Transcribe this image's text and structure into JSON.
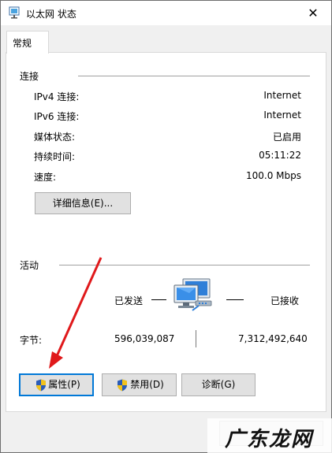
{
  "window": {
    "title": "以太网 状态",
    "close_glyph": "✕"
  },
  "tabs": [
    {
      "label": "常规"
    }
  ],
  "connection": {
    "group_label": "连接",
    "rows": [
      {
        "label": "IPv4 连接:",
        "value": "Internet"
      },
      {
        "label": "IPv6 连接:",
        "value": "Internet"
      },
      {
        "label": "媒体状态:",
        "value": "已启用"
      },
      {
        "label": "持续时间:",
        "value": "05:11:22"
      },
      {
        "label": "速度:",
        "value": "100.0 Mbps"
      }
    ],
    "details_button": "详细信息(E)..."
  },
  "activity": {
    "group_label": "活动",
    "sent_label": "已发送",
    "received_label": "已接收",
    "bytes_label": "字节:",
    "bytes_sent": "596,039,087",
    "bytes_received": "7,312,492,640",
    "network_icon": "network-computers-icon"
  },
  "buttons": {
    "properties": "属性(P)",
    "disable": "禁用(D)",
    "diagnose": "诊断(G)"
  },
  "watermark": {
    "text": "广东龙网",
    "icon": "watermark-logo"
  },
  "colors": {
    "arrow": "#e0191b",
    "accent": "#0078d7",
    "shield_blue": "#2a5cb8",
    "shield_yellow": "#f2c21b"
  }
}
